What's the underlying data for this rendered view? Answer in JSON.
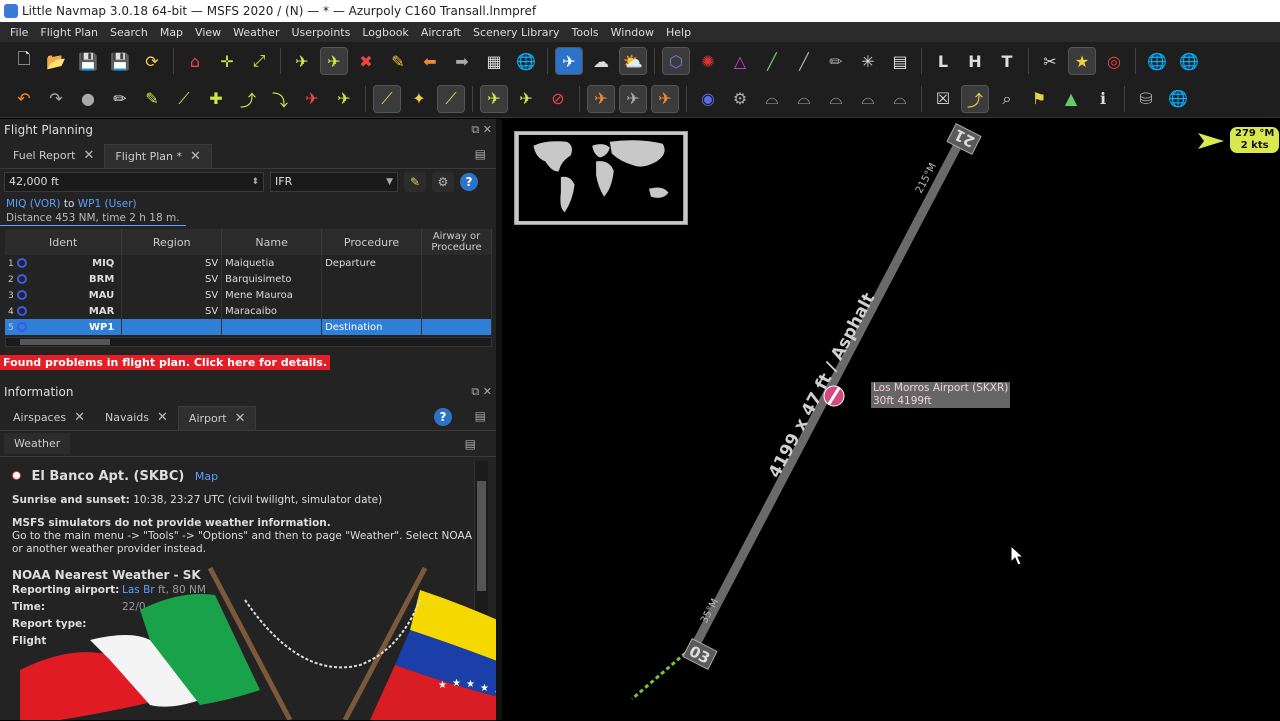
{
  "window": {
    "title": "Little Navmap 3.0.18 64-bit — MSFS 2020 / (N) — * — Azurpoly C160 Transall.lnmpref"
  },
  "menu": [
    "File",
    "Flight Plan",
    "Search",
    "Map",
    "View",
    "Weather",
    "Userpoints",
    "Logbook",
    "Aircraft",
    "Scenery Library",
    "Tools",
    "Window",
    "Help"
  ],
  "flight_planning": {
    "dock_title": "Flight Planning",
    "tabs": [
      {
        "label": "Fuel Report"
      },
      {
        "label": "Flight Plan *"
      }
    ],
    "altitude": "42,000 ft",
    "plan_type": "IFR",
    "route_from": "MIQ (VOR)",
    "route_to_word": "to",
    "route_to": "WP1 (User)",
    "distance": "Distance 453 NM, time 2 h 18 m.",
    "columns": [
      "Ident",
      "Region",
      "Name",
      "Procedure",
      "Airway or Procedure"
    ],
    "rows": [
      {
        "n": "1",
        "ident": "MIQ",
        "region": "SV",
        "name": "Maiquetia",
        "procedure": "Departure"
      },
      {
        "n": "2",
        "ident": "BRM",
        "region": "SV",
        "name": "Barquisimeto",
        "procedure": ""
      },
      {
        "n": "3",
        "ident": "MAU",
        "region": "SV",
        "name": "Mene Mauroa",
        "procedure": ""
      },
      {
        "n": "4",
        "ident": "MAR",
        "region": "SV",
        "name": "Maracaibo",
        "procedure": ""
      },
      {
        "n": "5",
        "ident": "WP1",
        "region": "",
        "name": "",
        "procedure": "Destination"
      }
    ],
    "problems": "Found problems in flight plan. Click here for details."
  },
  "information": {
    "dock_title": "Information",
    "tabs": [
      {
        "label": "Airspaces"
      },
      {
        "label": "Navaids"
      },
      {
        "label": "Airport"
      }
    ],
    "subtab": "Weather",
    "airport_name": "El Banco Apt. (SKBC)",
    "map_link": "Map",
    "sunrise_label": "Sunrise and sunset:",
    "sunrise_value": "10:38, 23:27 UTC (civil twilight, simulator date)",
    "msfs_note_title": "MSFS simulators do not provide weather information.",
    "msfs_note_body": "Go to the main menu -> \"Tools\" -> \"Options\" and then to page \"Weather\". Select NOAA or another weather provider instead.",
    "noaa_title": "NOAA Nearest Weather - SK",
    "weather_rows": [
      {
        "k": "Reporting airport:",
        "v_link": "Las Br",
        "v": "ft, 80 NM"
      },
      {
        "k": "Time:",
        "v_link": "",
        "v": "22/0"
      },
      {
        "k": "Report type:",
        "v_link": "",
        "v": ""
      },
      {
        "k": "Flight",
        "v_link": "",
        "v": ""
      }
    ]
  },
  "map": {
    "runway_label": "4199 x 47 ft / Asphalt",
    "runway_end_north": "21",
    "runway_end_south": "03",
    "heading_north": "215°M",
    "heading_south": "35°M",
    "airport_label": "Los Morros Airport (SKXR)",
    "airport_sub": "30ft   4199ft",
    "wind_direction": "279 °M",
    "wind_speed": "2 kts"
  },
  "colors": {
    "accent": "#2f7fd6",
    "problem": "#e41e26",
    "link": "#5aa0ff",
    "wind": "#d9e84f"
  }
}
